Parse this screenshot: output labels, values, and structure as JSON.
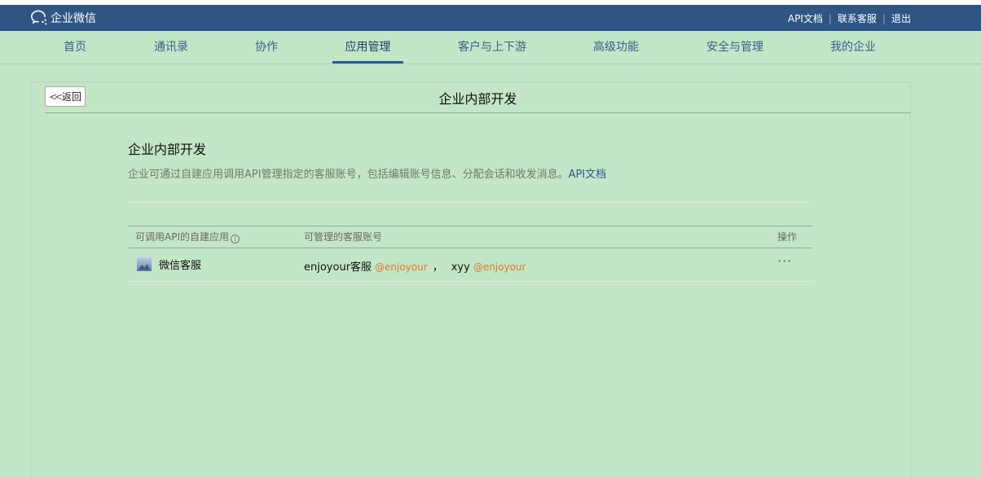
{
  "header": {
    "brand": "企业微信",
    "links": [
      "API文档",
      "联系客服",
      "退出"
    ]
  },
  "nav": {
    "items": [
      {
        "label": "首页"
      },
      {
        "label": "通讯录"
      },
      {
        "label": "协作"
      },
      {
        "label": "应用管理",
        "active": true
      },
      {
        "label": "客户与上下游"
      },
      {
        "label": "高级功能"
      },
      {
        "label": "安全与管理"
      },
      {
        "label": "我的企业"
      }
    ]
  },
  "panel": {
    "back_label": "返回",
    "title": "企业内部开发"
  },
  "section": {
    "title": "企业内部开发",
    "desc": "企业可通过自建应用调用API管理指定的客服账号，包括编辑账号信息、分配会话和收发消息。",
    "desc_link": "API文档"
  },
  "table": {
    "headers": [
      "可调用API的自建应用",
      "可管理的客服账号",
      "操作"
    ],
    "rows": [
      {
        "app_name": "微信客服",
        "accounts": [
          {
            "name": "enjoyour客服",
            "corp": "@enjoyour"
          },
          {
            "name": "xyy",
            "corp": "@enjoyour"
          }
        ],
        "action": "···"
      }
    ]
  },
  "colors": {
    "background": "#c2e6c6",
    "header": "#2f5585",
    "accent": "#2c5a94",
    "tag": "#e07a2f"
  }
}
